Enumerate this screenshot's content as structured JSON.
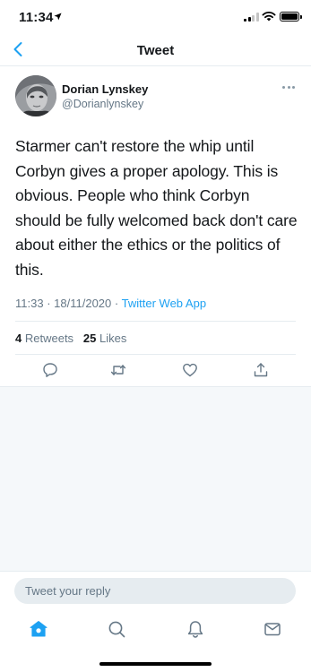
{
  "status_bar": {
    "time": "11:34",
    "signal_bars": 4,
    "signal_active": 2
  },
  "nav": {
    "title": "Tweet",
    "back_icon": "chevron-left-icon"
  },
  "tweet": {
    "display_name": "Dorian Lynskey",
    "handle": "@Dorianlynskey",
    "text": "Starmer can't restore the whip until Corbyn gives a proper apology. This is obvious. People who think Corbyn should be fully welcomed back don't care about either the ethics or the politics of this.",
    "time": "11:33",
    "date": "18/11/2020",
    "separator": "·",
    "source": "Twitter Web App",
    "retweets_count": "4",
    "retweets_label": "Retweets",
    "likes_count": "25",
    "likes_label": "Likes"
  },
  "actions": [
    "reply-icon",
    "retweet-icon",
    "like-icon",
    "share-icon"
  ],
  "reply": {
    "placeholder": "Tweet your reply"
  },
  "tabs": [
    "home-icon",
    "search-icon",
    "notifications-icon",
    "messages-icon"
  ],
  "colors": {
    "accent": "#1da1f2",
    "text": "#14171a",
    "muted": "#657786",
    "border": "#e6ecf0",
    "feed_bg": "#f5f8fa"
  }
}
